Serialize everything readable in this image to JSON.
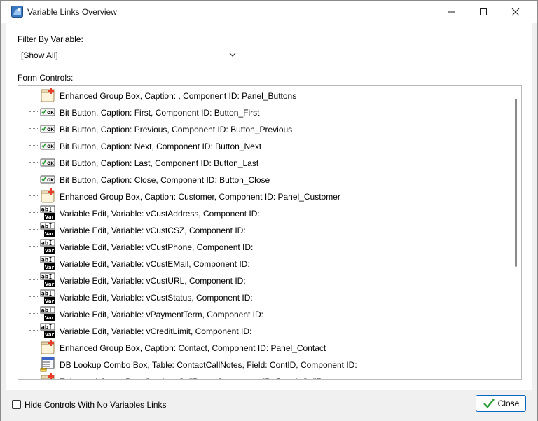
{
  "window": {
    "title": "Variable Links Overview",
    "icons": {
      "app": "app-icon",
      "minimize": "minimize-icon",
      "maximize": "maximize-icon",
      "close": "close-icon"
    }
  },
  "filter": {
    "label": "Filter By Variable:",
    "selected": "[Show All]"
  },
  "controls_label": "Form Controls:",
  "tree_items": [
    {
      "icon": "group-box-icon",
      "label": "Enhanced Group Box, Caption: , Component ID: Panel_Buttons"
    },
    {
      "icon": "bit-button-icon",
      "label": "Bit Button, Caption: First, Component ID: Button_First"
    },
    {
      "icon": "bit-button-icon",
      "label": "Bit Button, Caption: Previous, Component ID: Button_Previous"
    },
    {
      "icon": "bit-button-icon",
      "label": "Bit Button, Caption: Next, Component ID: Button_Next"
    },
    {
      "icon": "bit-button-icon",
      "label": "Bit Button, Caption: Last, Component ID: Button_Last"
    },
    {
      "icon": "bit-button-icon",
      "label": "Bit Button, Caption: Close, Component ID: Button_Close"
    },
    {
      "icon": "group-box-icon",
      "label": "Enhanced Group Box, Caption: Customer, Component ID: Panel_Customer"
    },
    {
      "icon": "variable-edit-icon",
      "label": "Variable Edit, Variable: vCustAddress, Component ID:"
    },
    {
      "icon": "variable-edit-icon",
      "label": "Variable Edit, Variable: vCustCSZ, Component ID:"
    },
    {
      "icon": "variable-edit-icon",
      "label": "Variable Edit, Variable: vCustPhone, Component ID:"
    },
    {
      "icon": "variable-edit-icon",
      "label": "Variable Edit, Variable: vCustEMail, Component ID:"
    },
    {
      "icon": "variable-edit-icon",
      "label": "Variable Edit, Variable: vCustURL, Component ID:"
    },
    {
      "icon": "variable-edit-icon",
      "label": "Variable Edit, Variable: vCustStatus, Component ID:"
    },
    {
      "icon": "variable-edit-icon",
      "label": "Variable Edit, Variable: vPaymentTerm, Component ID:"
    },
    {
      "icon": "variable-edit-icon",
      "label": "Variable Edit, Variable: vCreditLimit, Component ID:"
    },
    {
      "icon": "group-box-icon",
      "label": "Enhanced Group Box, Caption: Contact, Component ID: Panel_Contact"
    },
    {
      "icon": "db-lookup-combo-icon",
      "label": "DB Lookup Combo Box, Table: ContactCallNotes, Field: ContID, Component ID:"
    },
    {
      "icon": "group-box-icon",
      "label": "Enhanced Group Box, Caption: CallPane, Component ID: Panel_CallPane"
    }
  ],
  "icon_text": {
    "ok": "OK",
    "ab": "ab",
    "var": "Var"
  },
  "hide_checkbox": {
    "label": "Hide Controls With No Variables Links",
    "checked": false
  },
  "close_button": {
    "label": "Close",
    "icon": "checkmark-icon"
  },
  "colors": {
    "accent": "#0067c0",
    "check_green": "#2e9e3a"
  }
}
